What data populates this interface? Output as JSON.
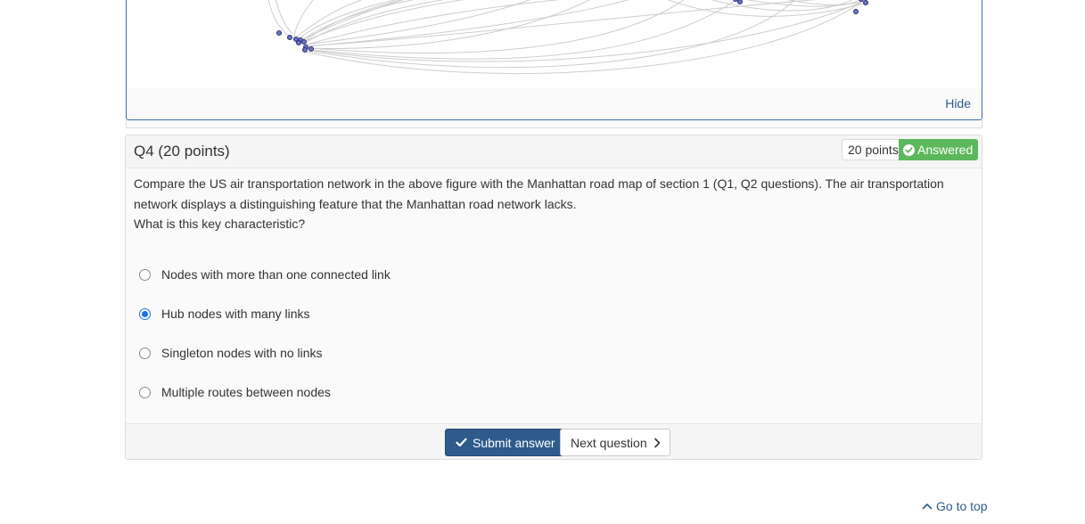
{
  "figure": {
    "hide_label": "Hide"
  },
  "question": {
    "title": "Q4 (20 points)",
    "points_badge": "20 points",
    "status_badge": "Answered",
    "prompt_line1": "Compare the US air transportation network in the above figure with the Manhattan road map of section 1 (Q1, Q2 questions). The air transportation network displays a distinguishing feature that the Manhattan road network lacks.",
    "prompt_line2": "What is this key characteristic?",
    "options": [
      {
        "label": "Nodes with more than one connected link",
        "selected": false
      },
      {
        "label": "Hub nodes with many links",
        "selected": true
      },
      {
        "label": "Singleton nodes with no links",
        "selected": false
      },
      {
        "label": "Multiple routes between nodes",
        "selected": false
      }
    ]
  },
  "footer": {
    "submit_label": "Submit answer",
    "next_label": "Next question"
  },
  "go_top_label": "Go to top",
  "colors": {
    "accent": "#2e5b8a",
    "answered": "#5cb85c",
    "link": "#2f5d8a",
    "node_fill": "#6b73c9",
    "node_stroke": "#2b2f6e",
    "edge": "#c8c8c8"
  }
}
